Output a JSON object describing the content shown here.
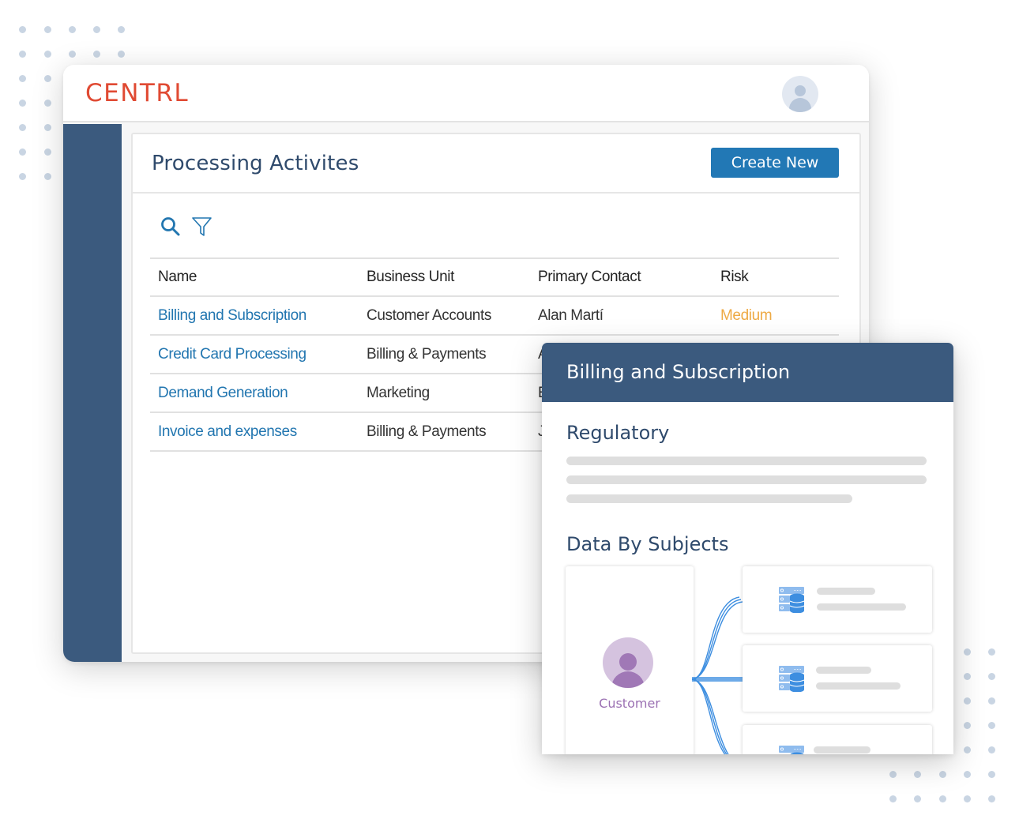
{
  "app": {
    "logo_text": "CENTRL"
  },
  "header": {
    "user_avatar": "user-avatar-icon"
  },
  "main": {
    "title": "Processing Activites",
    "create_button_label": "Create New",
    "tools": {
      "search_icon": "search-icon",
      "filter_icon": "filter-icon"
    },
    "table": {
      "columns": [
        "Name",
        "Business Unit",
        "Primary Contact",
        "Risk"
      ],
      "rows": [
        {
          "name": "Billing and Subscription",
          "business_unit": "Customer Accounts",
          "primary_contact": "Alan Martí",
          "risk": "Medium"
        },
        {
          "name": "Credit Card Processing",
          "business_unit": "Billing & Payments",
          "primary_contact": "A",
          "risk": ""
        },
        {
          "name": "Demand Generation",
          "business_unit": "Marketing",
          "primary_contact": "E",
          "risk": ""
        },
        {
          "name": "Invoice and expenses",
          "business_unit": "Billing & Payments",
          "primary_contact": "J",
          "risk": ""
        }
      ]
    }
  },
  "detail_panel": {
    "title": "Billing and Subscription",
    "regulatory_heading": "Regulatory",
    "data_subjects_heading": "Data By Subjects",
    "subject": {
      "label": "Customer",
      "icon": "customer-avatar-icon"
    },
    "sources": [
      {
        "icon": "database-server-icon"
      },
      {
        "icon": "database-server-icon"
      },
      {
        "icon": "database-server-icon"
      }
    ]
  },
  "colors": {
    "brand": "#e04a33",
    "navy": "#3b5a7e",
    "primary_button": "#2278b5",
    "link": "#2276b0",
    "risk_medium": "#eeaa45",
    "subject_purple": "#a078b6",
    "connector_blue": "#3d8ee0"
  }
}
